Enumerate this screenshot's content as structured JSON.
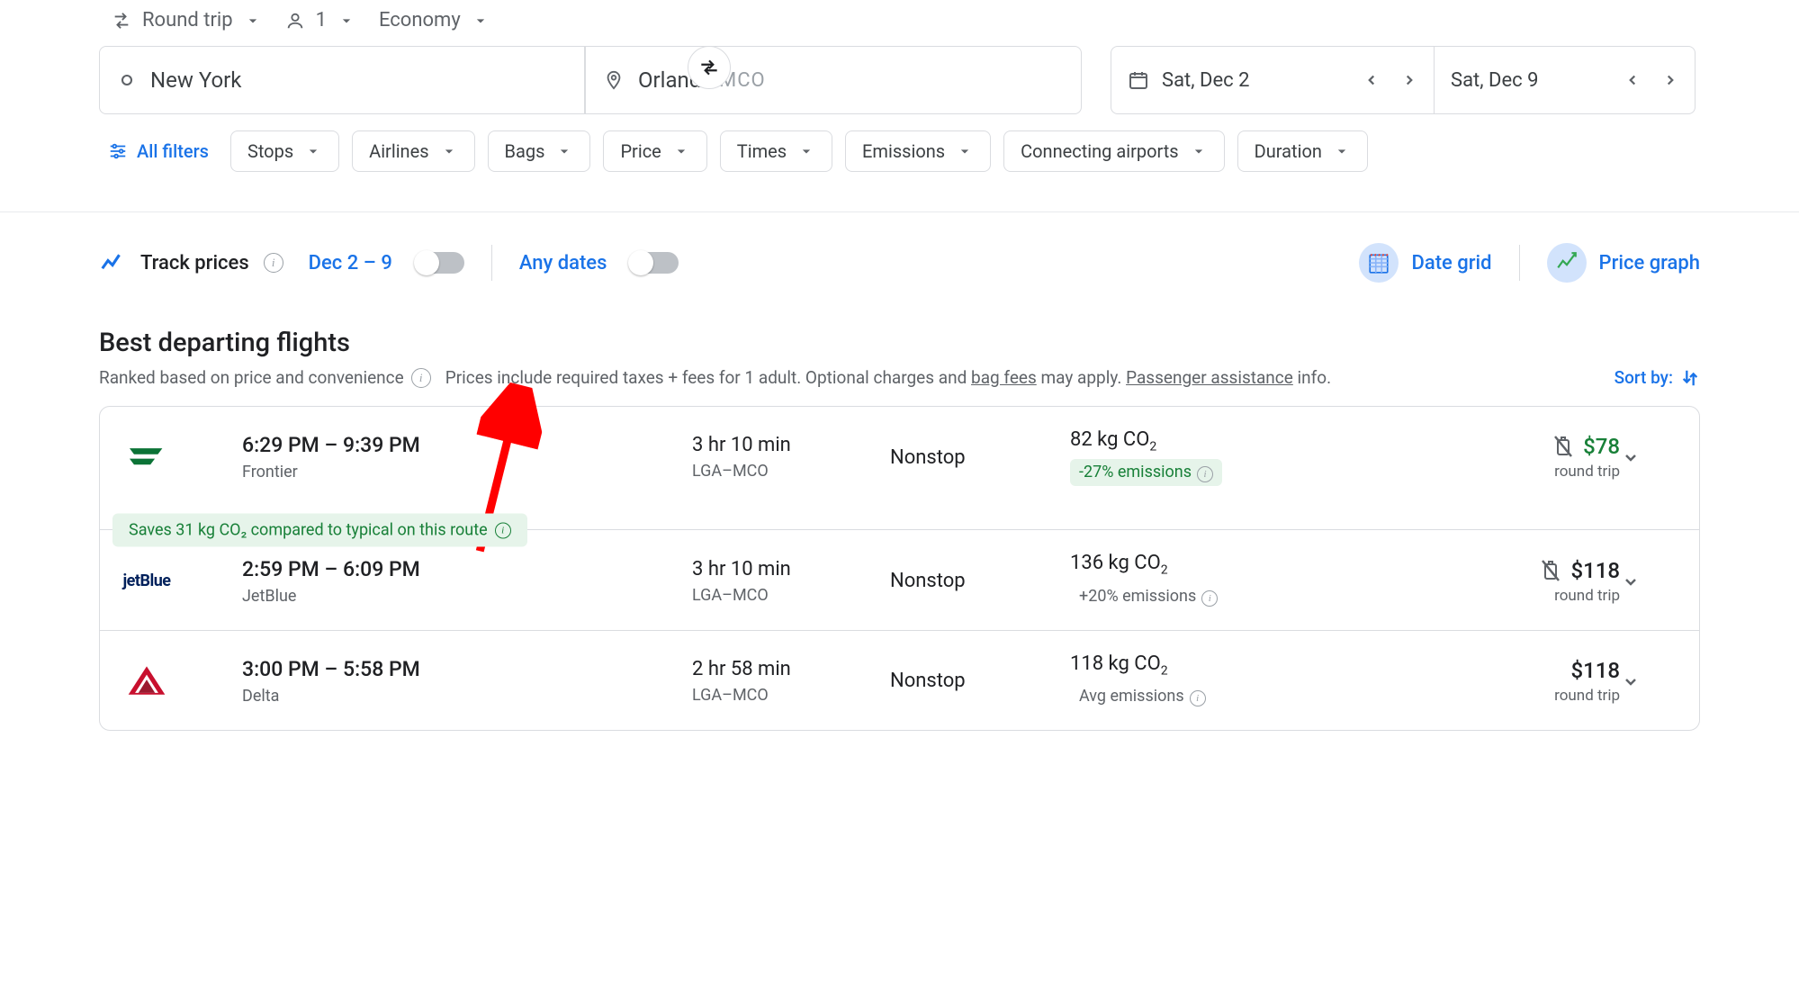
{
  "trip": {
    "type": "Round trip",
    "passengers": "1",
    "cabin": "Economy"
  },
  "search": {
    "origin": "New York",
    "destination": "Orlando",
    "dest_iata": "MCO",
    "depart": "Sat, Dec 2",
    "return": "Sat, Dec 9"
  },
  "filters": {
    "all_label": "All filters",
    "chips": [
      "Stops",
      "Airlines",
      "Bags",
      "Price",
      "Times",
      "Emissions",
      "Connecting airports",
      "Duration"
    ]
  },
  "track": {
    "label": "Track prices",
    "dates_short": "Dec 2 – 9",
    "any_dates": "Any dates"
  },
  "tools": {
    "date_grid": "Date grid",
    "price_graph": "Price graph"
  },
  "section": {
    "title": "Best departing flights",
    "sub1": "Ranked based on price and convenience",
    "sub2a": "Prices include required taxes + fees for 1 adult. Optional charges and ",
    "bag_fees": "bag fees",
    "sub2b": " may apply. ",
    "passenger_assist": "Passenger assistance",
    "sub2c": " info.",
    "sort_by": "Sort by:"
  },
  "results": [
    {
      "airline": "Frontier",
      "airline_logo": "frontier",
      "times": "6:29 PM – 9:39 PM",
      "duration": "3 hr 10 min",
      "route": "LGA–MCO",
      "stops": "Nonstop",
      "co2": "82 kg CO",
      "emissions_text": "-27% emissions",
      "emissions_class": "good",
      "price": "$78",
      "price_green": true,
      "savings_banner": "Saves 31 kg CO₂ compared to typical on this route",
      "no_carryon": true,
      "round_trip": "round trip"
    },
    {
      "airline": "JetBlue",
      "airline_logo": "jetblue",
      "times": "2:59 PM – 6:09 PM",
      "duration": "3 hr 10 min",
      "route": "LGA–MCO",
      "stops": "Nonstop",
      "co2": "136 kg CO",
      "emissions_text": "+20% emissions",
      "emissions_class": "bad",
      "price": "$118",
      "price_green": false,
      "no_carryon": true,
      "round_trip": "round trip"
    },
    {
      "airline": "Delta",
      "airline_logo": "delta",
      "times": "3:00 PM – 5:58 PM",
      "duration": "2 hr 58 min",
      "route": "LGA–MCO",
      "stops": "Nonstop",
      "co2": "118 kg CO",
      "emissions_text": "Avg emissions",
      "emissions_class": "bad",
      "price": "$118",
      "price_green": false,
      "no_carryon": false,
      "round_trip": "round trip"
    }
  ]
}
